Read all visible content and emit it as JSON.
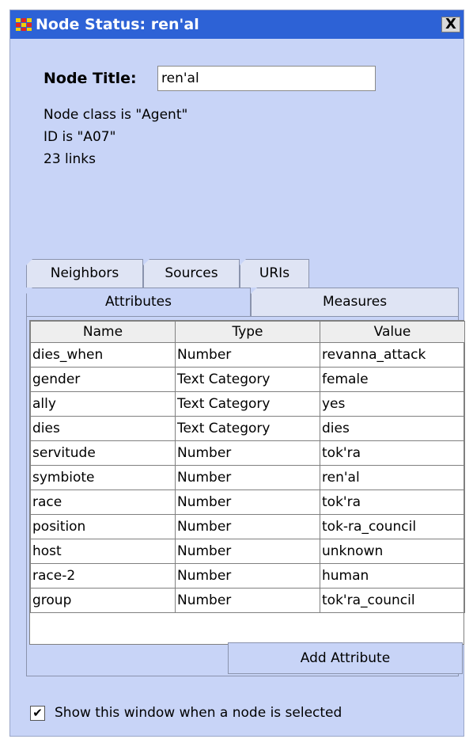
{
  "window": {
    "title": "Node Status: ren'al",
    "close_label": "X"
  },
  "node": {
    "title_label": "Node Title:",
    "title_value": "ren'al",
    "class_text": "Node class is \"Agent\"",
    "id_text": "ID is \"A07\"",
    "links_text": "23 links"
  },
  "tabs": {
    "top": [
      "Neighbors",
      "Sources",
      "URIs"
    ],
    "bottom": [
      "Attributes",
      "Measures"
    ],
    "active": "Attributes"
  },
  "table": {
    "headers": [
      "Name",
      "Type",
      "Value"
    ],
    "rows": [
      [
        "dies_when",
        "Number",
        "revanna_attack"
      ],
      [
        "gender",
        "Text Category",
        "female"
      ],
      [
        "ally",
        "Text Category",
        "yes"
      ],
      [
        "dies",
        "Text Category",
        "dies"
      ],
      [
        "servitude",
        "Number",
        "tok'ra"
      ],
      [
        "symbiote",
        "Number",
        "ren'al"
      ],
      [
        "race",
        "Number",
        "tok'ra"
      ],
      [
        "position",
        "Number",
        "tok-ra_council"
      ],
      [
        "host",
        "Number",
        "unknown"
      ],
      [
        "race-2",
        "Number",
        "human"
      ],
      [
        "group",
        "Number",
        "tok'ra_council"
      ]
    ]
  },
  "add_attribute_label": "Add Attribute",
  "show_window": {
    "checked": true,
    "label": "Show this window when a node is selected",
    "check_glyph": "✔"
  },
  "colors": {
    "titlebar": "#2d62d6",
    "panel": "#c8d4f7"
  },
  "icons": {
    "app": "app-grid-icon",
    "close": "close-icon"
  }
}
